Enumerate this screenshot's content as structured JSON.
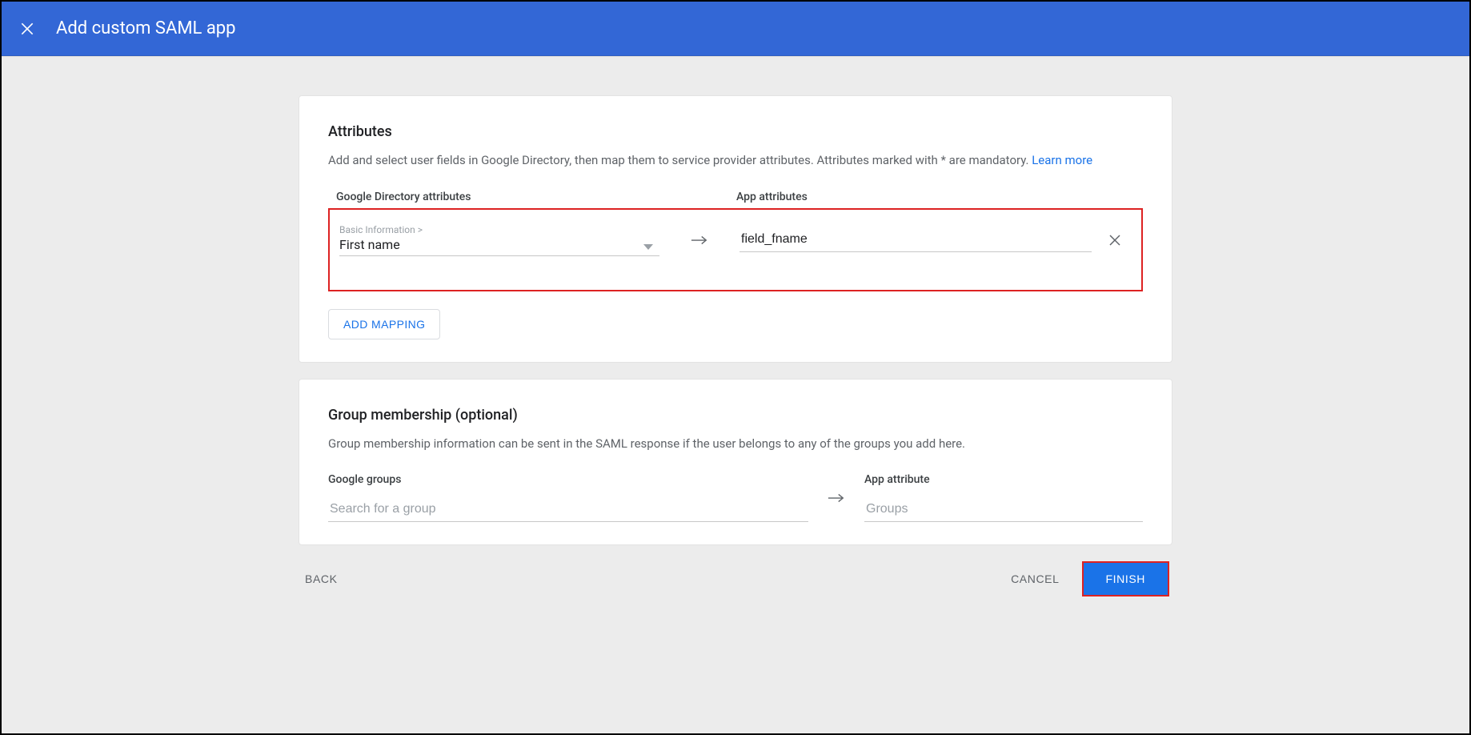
{
  "header": {
    "title": "Add custom SAML app"
  },
  "attributes": {
    "heading": "Attributes",
    "description": "Add and select user fields in Google Directory, then map them to service provider attributes. Attributes marked with * are mandatory. ",
    "learn_more": "Learn more",
    "col_left": "Google Directory attributes",
    "col_right": "App attributes",
    "mapping": {
      "crumb": "Basic Information >",
      "value": "First name",
      "app_value": "field_fname"
    },
    "add_mapping": "ADD MAPPING"
  },
  "groups": {
    "heading": "Group membership (optional)",
    "description": "Group membership information can be sent in the SAML response if the user belongs to any of the groups you add here.",
    "col_left": "Google groups",
    "col_right": "App attribute",
    "search_placeholder": "Search for a group",
    "app_placeholder": "Groups"
  },
  "footer": {
    "back": "BACK",
    "cancel": "CANCEL",
    "finish": "FINISH"
  }
}
